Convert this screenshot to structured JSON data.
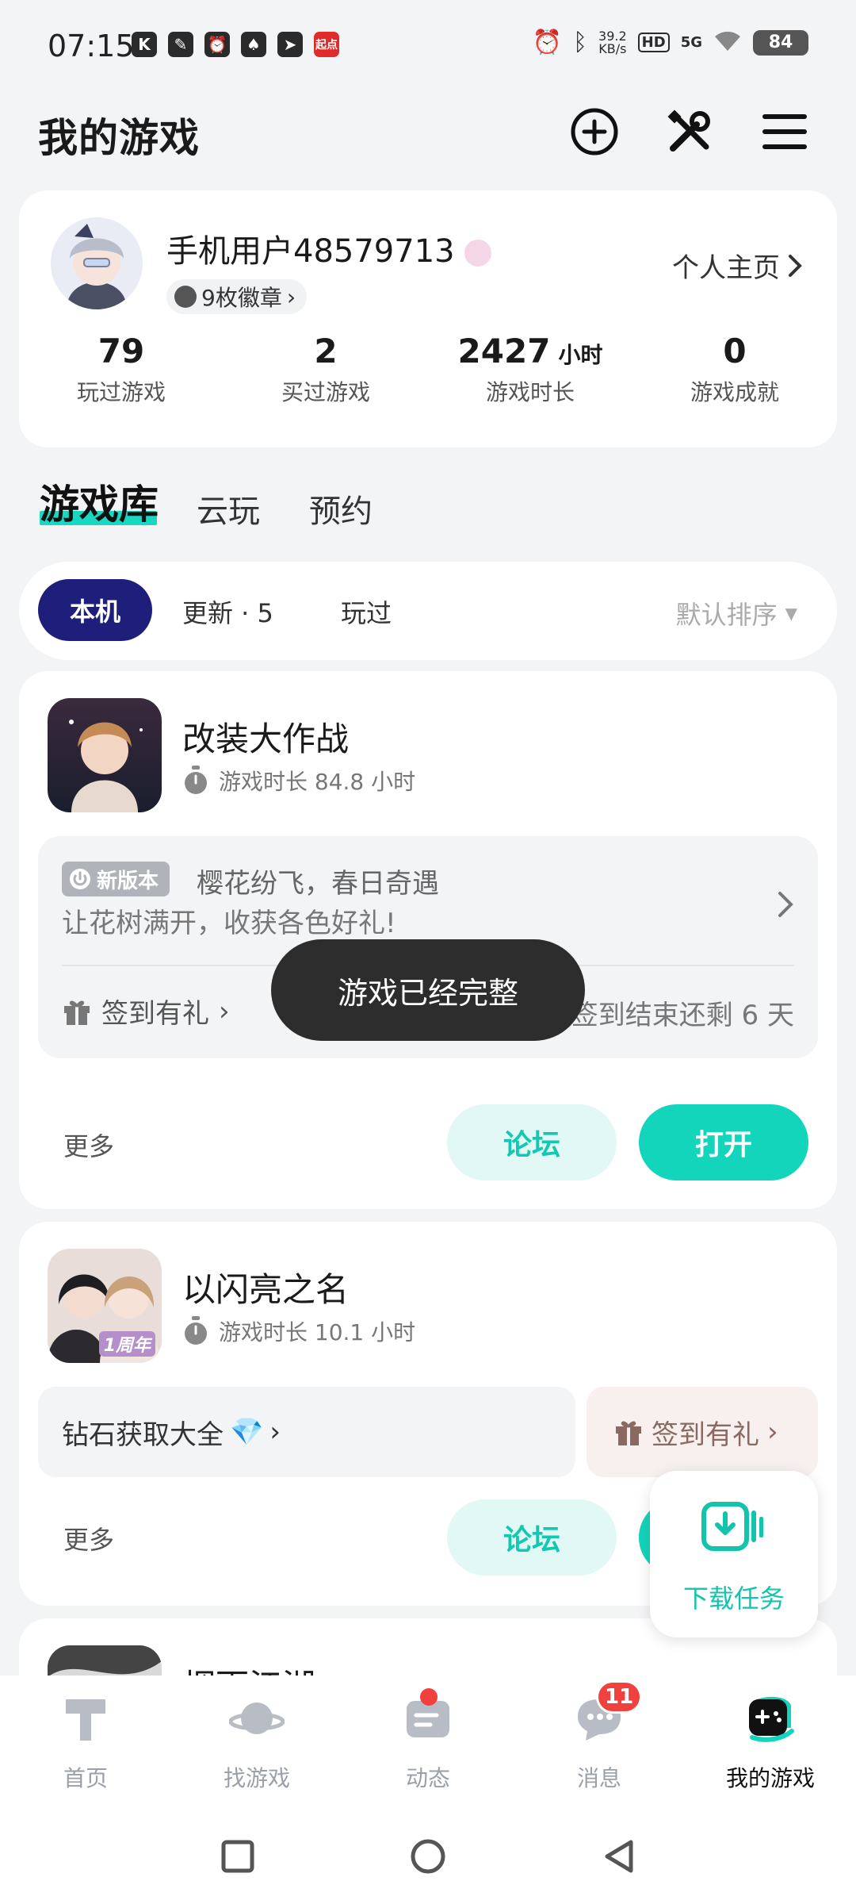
{
  "status_bar": {
    "time": "07:15",
    "speed_value": "39.2",
    "speed_unit": "KB/s",
    "hd": "HD",
    "network": "5G",
    "battery": "84",
    "app_icon_k": "K",
    "app_icon_news": "起点"
  },
  "header": {
    "title": "我的游戏",
    "icons": [
      "add-circle-icon",
      "tools-icon",
      "menu-icon"
    ]
  },
  "profile": {
    "username": "手机用户48579713",
    "badges_label": "9枚徽章",
    "homepage_label": "个人主页",
    "stats": [
      {
        "value": "79",
        "unit": "",
        "label": "玩过游戏"
      },
      {
        "value": "2",
        "unit": "",
        "label": "买过游戏"
      },
      {
        "value": "2427",
        "unit": "小时",
        "label": "游戏时长"
      },
      {
        "value": "0",
        "unit": "",
        "label": "游戏成就"
      }
    ]
  },
  "main_tabs": [
    {
      "label": "游戏库",
      "active": true
    },
    {
      "label": "云玩",
      "active": false
    },
    {
      "label": "预约",
      "active": false
    }
  ],
  "filters": {
    "active": "本机",
    "updates": "更新 · 5",
    "played": "玩过",
    "sort_label": "默认排序"
  },
  "games": [
    {
      "name": "改装大作战",
      "play_time": "游戏时长 84.8 小时",
      "version_tag": "新版本",
      "event_title": "樱花纷飞，春日奇遇",
      "event_desc": "让花树满开，收获各色好礼!",
      "checkin_label": "签到有礼",
      "countdown": "签到结束还剩 6 天",
      "more_label": "更多",
      "forum_label": "论坛",
      "open_label": "打开"
    },
    {
      "name": "以闪亮之名",
      "play_time": "游戏时长 10.1 小时",
      "diamond_label": "钻石获取大全",
      "checkin_label": "签到有礼",
      "more_label": "更多",
      "forum_label": "论坛",
      "icon_text": "1周年"
    },
    {
      "name": "烟雨江湖"
    }
  ],
  "toast": "游戏已经完整",
  "download_float": {
    "label": "下载任务"
  },
  "bottom_nav": [
    {
      "label": "首页",
      "active": false
    },
    {
      "label": "找游戏",
      "active": false
    },
    {
      "label": "动态",
      "active": false,
      "dot": true
    },
    {
      "label": "消息",
      "active": false,
      "badge": "11"
    },
    {
      "label": "我的游戏",
      "active": true
    }
  ],
  "colors": {
    "accent": "#13d5bb",
    "active_chip": "#1d1f7a",
    "badge_red": "#f0413e"
  }
}
